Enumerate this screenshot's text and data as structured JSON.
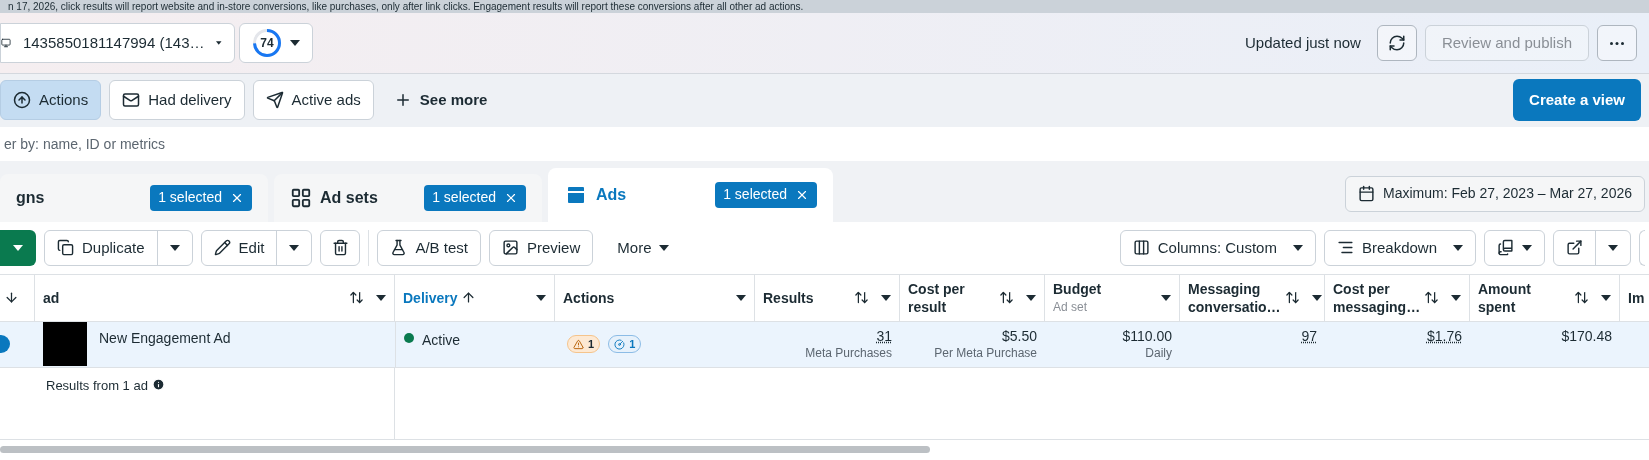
{
  "banner": {
    "text": "n 17, 2026, click results will report website and in-store conversions, like purchases, only after link clicks. Engagement results will report these conversions after all other ad actions."
  },
  "account": {
    "name": "1435850181147994 (143…",
    "score": "74"
  },
  "top_bar": {
    "status": "Updated just now",
    "review_button": {
      "label": "Review and publish",
      "disabled": true
    }
  },
  "filters": [
    {
      "label": "Actions",
      "selected": true
    },
    {
      "label": "Had delivery",
      "selected": false
    },
    {
      "label": "Active ads",
      "selected": false
    }
  ],
  "see_more": "See more",
  "create_view": "Create a view",
  "search": {
    "placeholder": "er by: name, ID or metrics"
  },
  "level_tabs": [
    {
      "label": "gns",
      "badge": "1 selected",
      "selected": false
    },
    {
      "label": "Ad sets",
      "badge": "1 selected",
      "selected": false
    },
    {
      "label": "Ads",
      "badge": "1 selected",
      "selected": true
    }
  ],
  "date_range": "Maximum: Feb 27, 2023 – Mar 27, 2026",
  "toolbar": {
    "duplicate": "Duplicate",
    "edit": "Edit",
    "ab_test": "A/B test",
    "preview": "Preview",
    "more": "More",
    "columns": "Columns: Custom",
    "breakdown": "Breakdown"
  },
  "table": {
    "columns": [
      {
        "label": "ad",
        "kind": "sortable",
        "sorted": false
      },
      {
        "label": "Delivery",
        "kind": "sortable",
        "sorted": true
      },
      {
        "label": "Actions",
        "kind": "plain",
        "sorted": false
      },
      {
        "label": "Results",
        "kind": "sortable",
        "sorted": false
      },
      {
        "label": "Cost per result",
        "kind": "sortable",
        "sorted": false
      },
      {
        "label": "Budget",
        "sub": "Ad set",
        "kind": "plain",
        "sorted": false
      },
      {
        "label": "Messaging conversatio…",
        "kind": "sortable",
        "sorted": false
      },
      {
        "label": "Cost per messaging…",
        "kind": "sortable",
        "sorted": false
      },
      {
        "label": "Amount spent",
        "kind": "sortable",
        "sorted": false
      },
      {
        "label": "Im",
        "kind": "cut",
        "sorted": false
      }
    ],
    "rows": [
      {
        "on": true,
        "cells": [
          {
            "kind": "name",
            "text": "New Engagement Ad"
          },
          {
            "kind": "status",
            "text": "Active",
            "color": "#0a7a4f"
          },
          {
            "kind": "badges",
            "warnings": "1",
            "actions": "1"
          },
          {
            "kind": "metric",
            "value": "31",
            "sub": "Meta Purchases",
            "dotted": true
          },
          {
            "kind": "metric",
            "value": "$5.50",
            "sub": "Per Meta Purchase",
            "dotted": false
          },
          {
            "kind": "metric",
            "value": "$110.00",
            "sub": "Daily",
            "dotted": false
          },
          {
            "kind": "metric",
            "value": "97",
            "dotted": true
          },
          {
            "kind": "metric",
            "value": "$1.76",
            "dotted": true
          },
          {
            "kind": "metric",
            "value": "$170.48",
            "dotted": false
          }
        ]
      }
    ],
    "summary": "Results from 1 ad"
  }
}
